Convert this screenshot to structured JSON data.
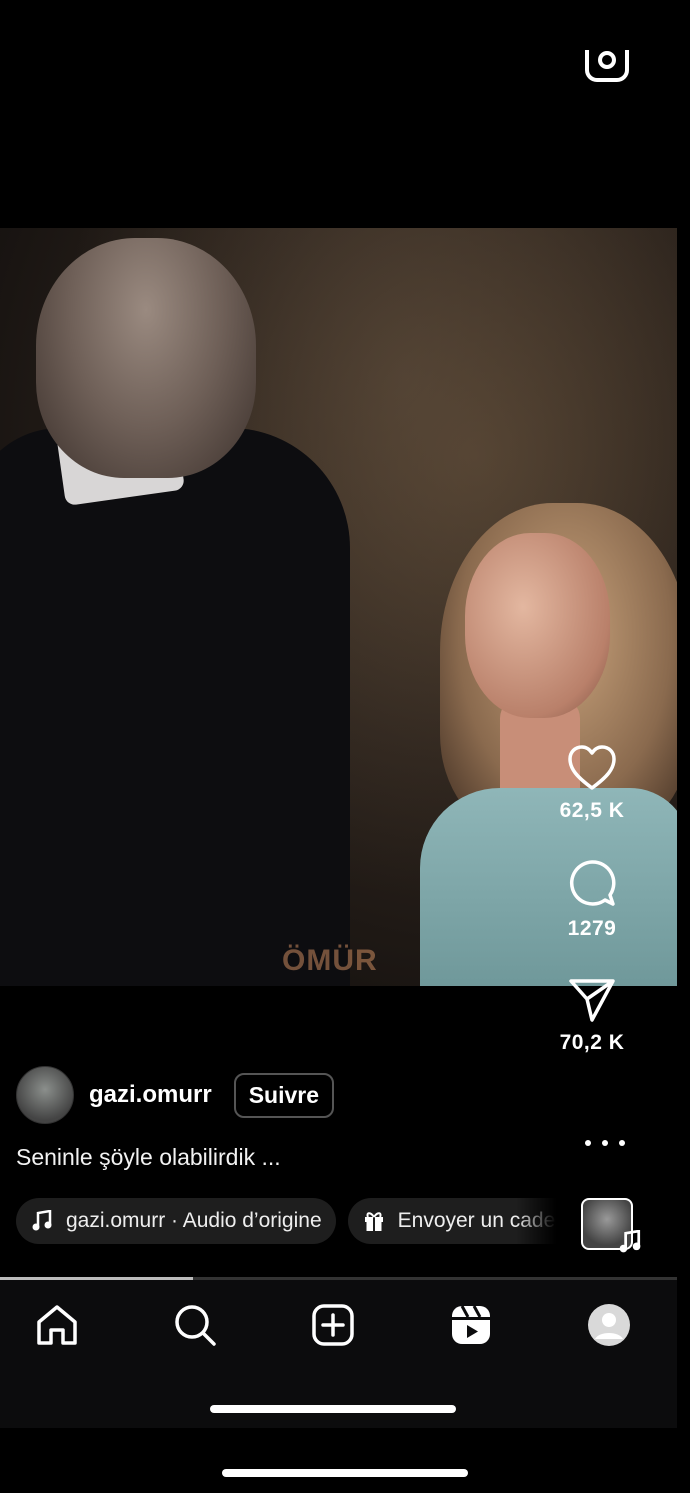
{
  "video": {
    "watermark": "ÖMÜR"
  },
  "actions": {
    "likes": "62,5 K",
    "comments": "1279",
    "shares": "70,2 K"
  },
  "author": {
    "username": "gazi.omurr",
    "follow_label": "Suivre"
  },
  "caption": "Seninle şöyle olabilirdik ...",
  "chips": {
    "audio": "gazi.omurr · Audio d’origine",
    "gift": "Envoyer un cadeau"
  },
  "playback": {
    "progress": 0.285
  },
  "tabbar": {
    "items": [
      "home-icon",
      "search-icon",
      "create-icon",
      "reels-icon",
      "profile-icon"
    ],
    "active": "reels-icon"
  }
}
